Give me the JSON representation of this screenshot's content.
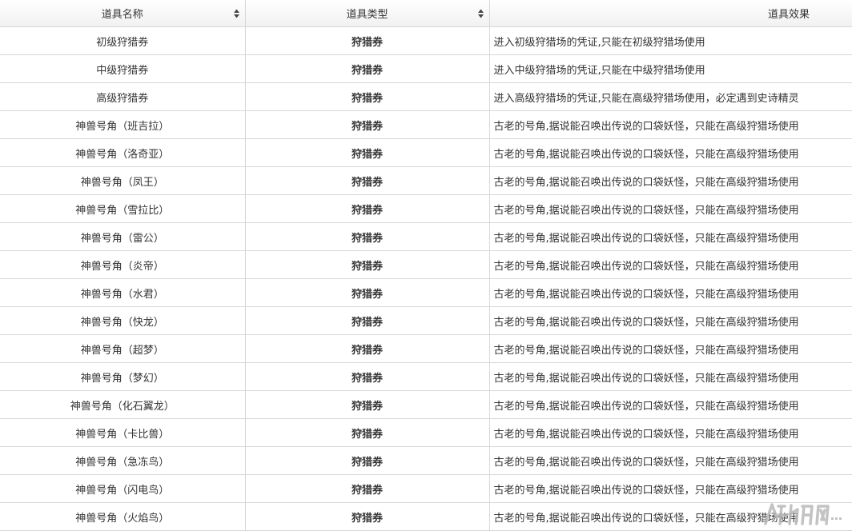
{
  "table": {
    "columns": [
      {
        "label": "道具名称",
        "sortable": true
      },
      {
        "label": "道具类型",
        "sortable": true
      },
      {
        "label": "道具效果",
        "sortable": false
      }
    ],
    "rows": [
      {
        "name": "初级狩猎券",
        "type": "狩猎券",
        "effect": "进入初级狩猎场的凭证,只能在初级狩猎场使用"
      },
      {
        "name": "中级狩猎券",
        "type": "狩猎券",
        "effect": "进入中级狩猎场的凭证,只能在中级狩猎场使用"
      },
      {
        "name": "高级狩猎券",
        "type": "狩猎券",
        "effect": "进入高级狩猎场的凭证,只能在高级狩猎场使用，必定遇到史诗精灵"
      },
      {
        "name": "神兽号角（班吉拉）",
        "type": "狩猎券",
        "effect": "古老的号角,据说能召唤出传说的口袋妖怪，只能在高级狩猎场使用"
      },
      {
        "name": "神兽号角（洛奇亚）",
        "type": "狩猎券",
        "effect": "古老的号角,据说能召唤出传说的口袋妖怪，只能在高级狩猎场使用"
      },
      {
        "name": "神兽号角（凤王）",
        "type": "狩猎券",
        "effect": "古老的号角,据说能召唤出传说的口袋妖怪，只能在高级狩猎场使用"
      },
      {
        "name": "神兽号角（雪拉比）",
        "type": "狩猎券",
        "effect": "古老的号角,据说能召唤出传说的口袋妖怪，只能在高级狩猎场使用"
      },
      {
        "name": "神兽号角（雷公）",
        "type": "狩猎券",
        "effect": "古老的号角,据说能召唤出传说的口袋妖怪，只能在高级狩猎场使用"
      },
      {
        "name": "神兽号角（炎帝）",
        "type": "狩猎券",
        "effect": "古老的号角,据说能召唤出传说的口袋妖怪，只能在高级狩猎场使用"
      },
      {
        "name": "神兽号角（水君）",
        "type": "狩猎券",
        "effect": "古老的号角,据说能召唤出传说的口袋妖怪，只能在高级狩猎场使用"
      },
      {
        "name": "神兽号角（快龙）",
        "type": "狩猎券",
        "effect": "古老的号角,据说能召唤出传说的口袋妖怪，只能在高级狩猎场使用"
      },
      {
        "name": "神兽号角（超梦）",
        "type": "狩猎券",
        "effect": "古老的号角,据说能召唤出传说的口袋妖怪，只能在高级狩猎场使用"
      },
      {
        "name": "神兽号角（梦幻）",
        "type": "狩猎券",
        "effect": "古老的号角,据说能召唤出传说的口袋妖怪，只能在高级狩猎场使用"
      },
      {
        "name": "神兽号角（化石翼龙）",
        "type": "狩猎券",
        "effect": "古老的号角,据说能召唤出传说的口袋妖怪，只能在高级狩猎场使用"
      },
      {
        "name": "神兽号角（卡比兽）",
        "type": "狩猎券",
        "effect": "古老的号角,据说能召唤出传说的口袋妖怪，只能在高级狩猎场使用"
      },
      {
        "name": "神兽号角（急冻鸟）",
        "type": "狩猎券",
        "effect": "古老的号角,据说能召唤出传说的口袋妖怪，只能在高级狩猎场使用"
      },
      {
        "name": "神兽号角（闪电鸟）",
        "type": "狩猎券",
        "effect": "古老的号角,据说能召唤出传说的口袋妖怪，只能在高级狩猎场使用"
      },
      {
        "name": "神兽号角（火焰鸟）",
        "type": "狩猎券",
        "effect": "古老的号角,据说能召唤出传说的口袋妖怪，只能在高级狩猎场使用"
      }
    ]
  },
  "colors": {
    "border": "#d7d7d7",
    "text": "#333333",
    "header_bg": "#f4f4f4",
    "watermark": "#b9b9b9"
  },
  "icons": {
    "sort": "sort-arrows-icon",
    "watermark": "site-logo-watermark-icon"
  }
}
